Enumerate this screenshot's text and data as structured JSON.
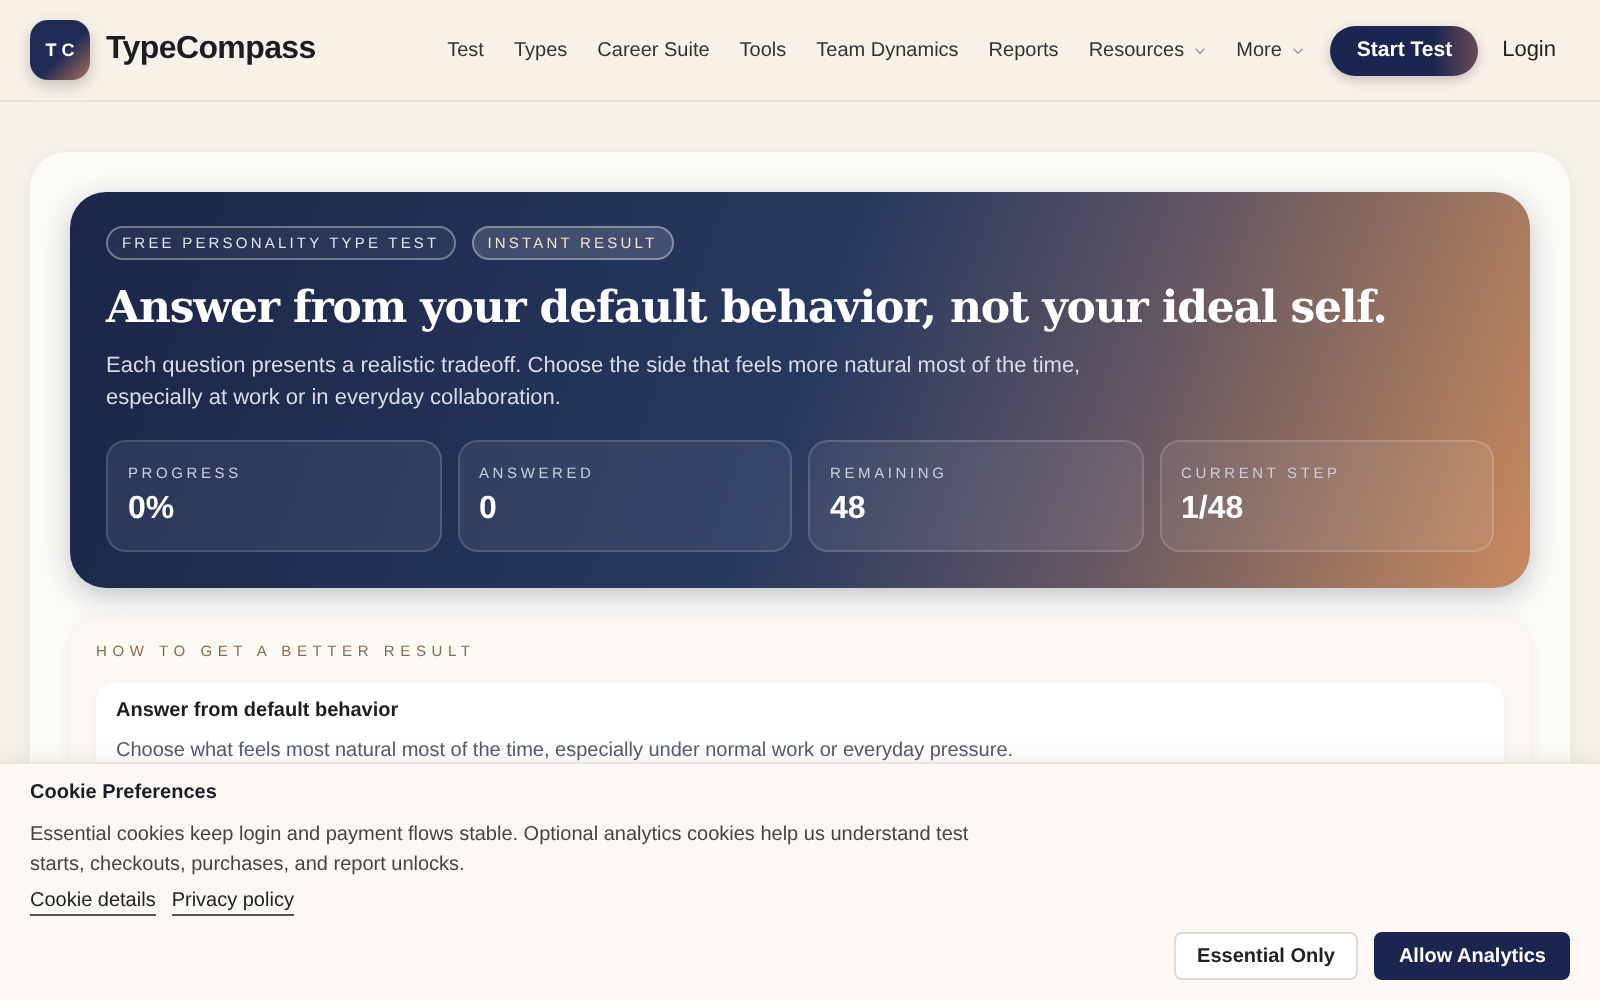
{
  "brand": {
    "mark": "T C",
    "name": "TypeCompass"
  },
  "nav": [
    {
      "label": "Test",
      "dropdown": false
    },
    {
      "label": "Types",
      "dropdown": false
    },
    {
      "label": "Career Suite",
      "dropdown": false
    },
    {
      "label": "Tools",
      "dropdown": false
    },
    {
      "label": "Team Dynamics",
      "dropdown": false
    },
    {
      "label": "Reports",
      "dropdown": false
    },
    {
      "label": "Resources",
      "dropdown": true
    },
    {
      "label": "More",
      "dropdown": true
    }
  ],
  "header_actions": {
    "primary": "Start Test",
    "secondary": "Login"
  },
  "hero": {
    "badges": [
      "FREE PERSONALITY TYPE TEST",
      "INSTANT RESULT"
    ],
    "title": "Answer from your default behavior, not your ideal self.",
    "subtitle": "Each question presents a realistic tradeoff. Choose the side that feels more natural most of the time, especially at work or in everyday collaboration.",
    "stats": [
      {
        "label": "PROGRESS",
        "value": "0%"
      },
      {
        "label": "ANSWERED",
        "value": "0"
      },
      {
        "label": "REMAINING",
        "value": "48"
      },
      {
        "label": "CURRENT STEP",
        "value": "1/48"
      }
    ]
  },
  "tips": {
    "heading": "HOW TO GET A BETTER RESULT",
    "items": [
      {
        "title": "Answer from default behavior",
        "text": "Choose what feels most natural most of the time, especially under normal work or everyday pressure."
      }
    ]
  },
  "cookie_banner": {
    "title": "Cookie Preferences",
    "text": "Essential cookies keep login and payment flows stable. Optional analytics cookies help us understand test starts, checkouts, purchases, and report unlocks.",
    "links": [
      "Cookie details",
      "Privacy policy"
    ],
    "buttons": [
      {
        "label": "Essential Only",
        "kind": "secondary"
      },
      {
        "label": "Allow Analytics",
        "kind": "primary"
      }
    ]
  }
}
